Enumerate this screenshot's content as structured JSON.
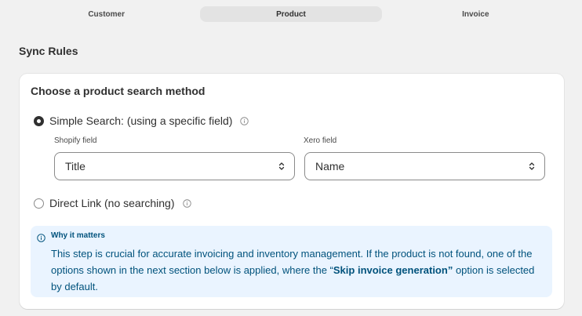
{
  "tabs": [
    {
      "label": "Customer",
      "active": false
    },
    {
      "label": "Product",
      "active": true
    },
    {
      "label": "Invoice",
      "active": false
    }
  ],
  "section_title": "Sync Rules",
  "card": {
    "title": "Choose a product search method",
    "options": [
      {
        "label": "Simple Search: (using a specific field)",
        "selected": true
      },
      {
        "label": "Direct Link (no searching)",
        "selected": false
      }
    ],
    "shopify_field": {
      "label": "Shopify field",
      "value": "Title"
    },
    "xero_field": {
      "label": "Xero field",
      "value": "Name"
    },
    "notice": {
      "title": "Why it matters",
      "body_before": "This step is crucial for accurate invoicing and inventory management. If the product is not found, one of the options shown in the next section below is applied, where the “",
      "body_bold": "Skip invoice generation”",
      "body_after": " option is selected by default."
    }
  },
  "colors": {
    "background": "#f1f1f1",
    "notice_bg": "#eaf4ff",
    "notice_text": "#00527c"
  },
  "icons": [
    "info-icon",
    "chevron-up-down-icon"
  ]
}
